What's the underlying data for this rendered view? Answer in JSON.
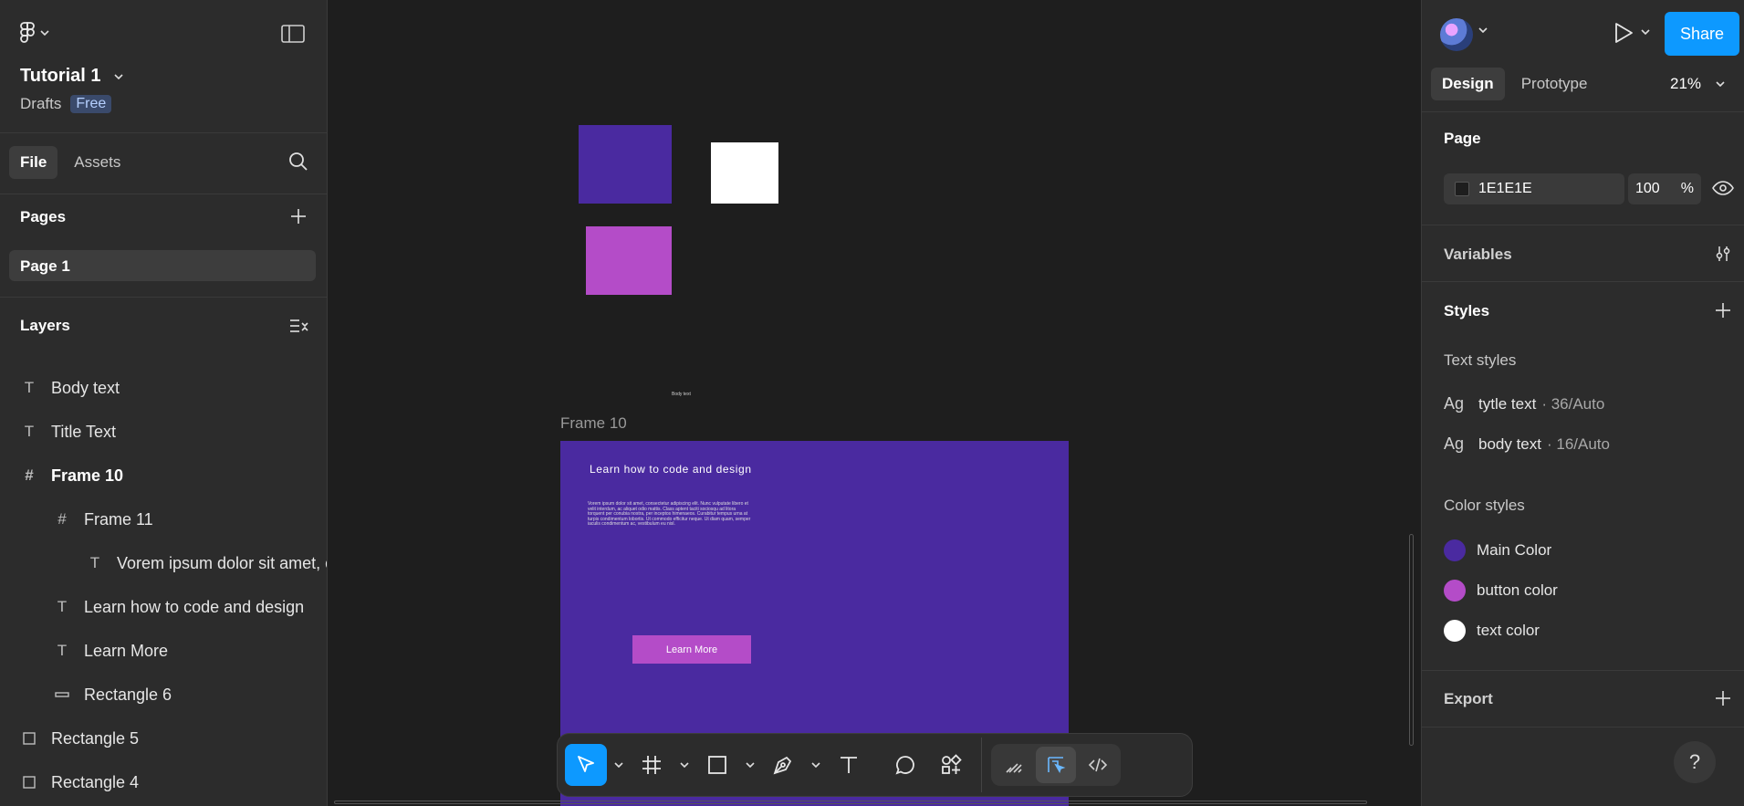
{
  "file": {
    "title": "Tutorial 1",
    "location": "Drafts",
    "plan_badge": "Free"
  },
  "left_tabs": [
    "File",
    "Assets"
  ],
  "pages": {
    "heading": "Pages",
    "items": [
      "Page 1"
    ]
  },
  "layers": {
    "heading": "Layers",
    "items": [
      {
        "label": "Body text",
        "icon": "text-icon"
      },
      {
        "label": "Title Text",
        "icon": "text-icon"
      },
      {
        "label": "Frame 10",
        "icon": "frame-icon"
      },
      {
        "label": "Frame 11",
        "icon": "frame-icon"
      },
      {
        "label": "Vorem ipsum dolor sit amet, c",
        "icon": "text-icon"
      },
      {
        "label": "Learn how to code and design",
        "icon": "text-icon"
      },
      {
        "label": "Learn More",
        "icon": "text-icon"
      },
      {
        "label": "Rectangle 6",
        "icon": "rectangle-icon"
      },
      {
        "label": "Rectangle 5",
        "icon": "rectangle-icon"
      },
      {
        "label": "Rectangle 4",
        "icon": "rectangle-icon"
      }
    ]
  },
  "canvas": {
    "frame_label": "Frame 10",
    "body_text_label": "Body text",
    "frame_title": "Learn how to code and design",
    "frame_body": "Vorem ipsum dolor sit amet, consectetur adipiscing elit. Nunc vulputate libero et velit interdum, ac aliquet odio mattis. Class aptent taciti sociosqu ad litora torquent per conubia nostra, per inceptos himenaeos. Curabitur tempus urna at turpis condimentum lobortis. Ut commodo efficitur neque. Ut diam quam, semper iaculis condimentum ac, vestibulum eu nisl.",
    "frame_button": "Learn More",
    "colors": {
      "main": "#4a2aa0",
      "button": "#b44cc8",
      "text": "#ffffff",
      "canvas_bg": "#1e1e1e"
    }
  },
  "toolbar": {
    "tools": [
      "move-tool",
      "frame-tool",
      "rectangle-tool",
      "pen-tool",
      "text-tool",
      "comment-tool",
      "actions-tool"
    ],
    "modes": [
      "draw-mode",
      "design-mode",
      "dev-mode"
    ]
  },
  "right": {
    "share_label": "Share",
    "tabs": [
      "Design",
      "Prototype"
    ],
    "zoom": "21%",
    "page_heading": "Page",
    "page_color": "1E1E1E",
    "page_opacity": "100",
    "opacity_unit": "%",
    "variables_heading": "Variables",
    "styles_heading": "Styles",
    "text_styles_heading": "Text styles",
    "text_styles": [
      {
        "glyph": "Ag",
        "name": "tytle text",
        "meta": "· 36/Auto"
      },
      {
        "glyph": "Ag",
        "name": "body text",
        "meta": "· 16/Auto"
      }
    ],
    "color_styles_heading": "Color styles",
    "color_styles": [
      {
        "name": "Main Color",
        "color": "#4a2aa0"
      },
      {
        "name": "button color",
        "color": "#b44cc8"
      },
      {
        "name": "text color",
        "color": "#ffffff"
      }
    ],
    "export_heading": "Export",
    "help_label": "?"
  }
}
